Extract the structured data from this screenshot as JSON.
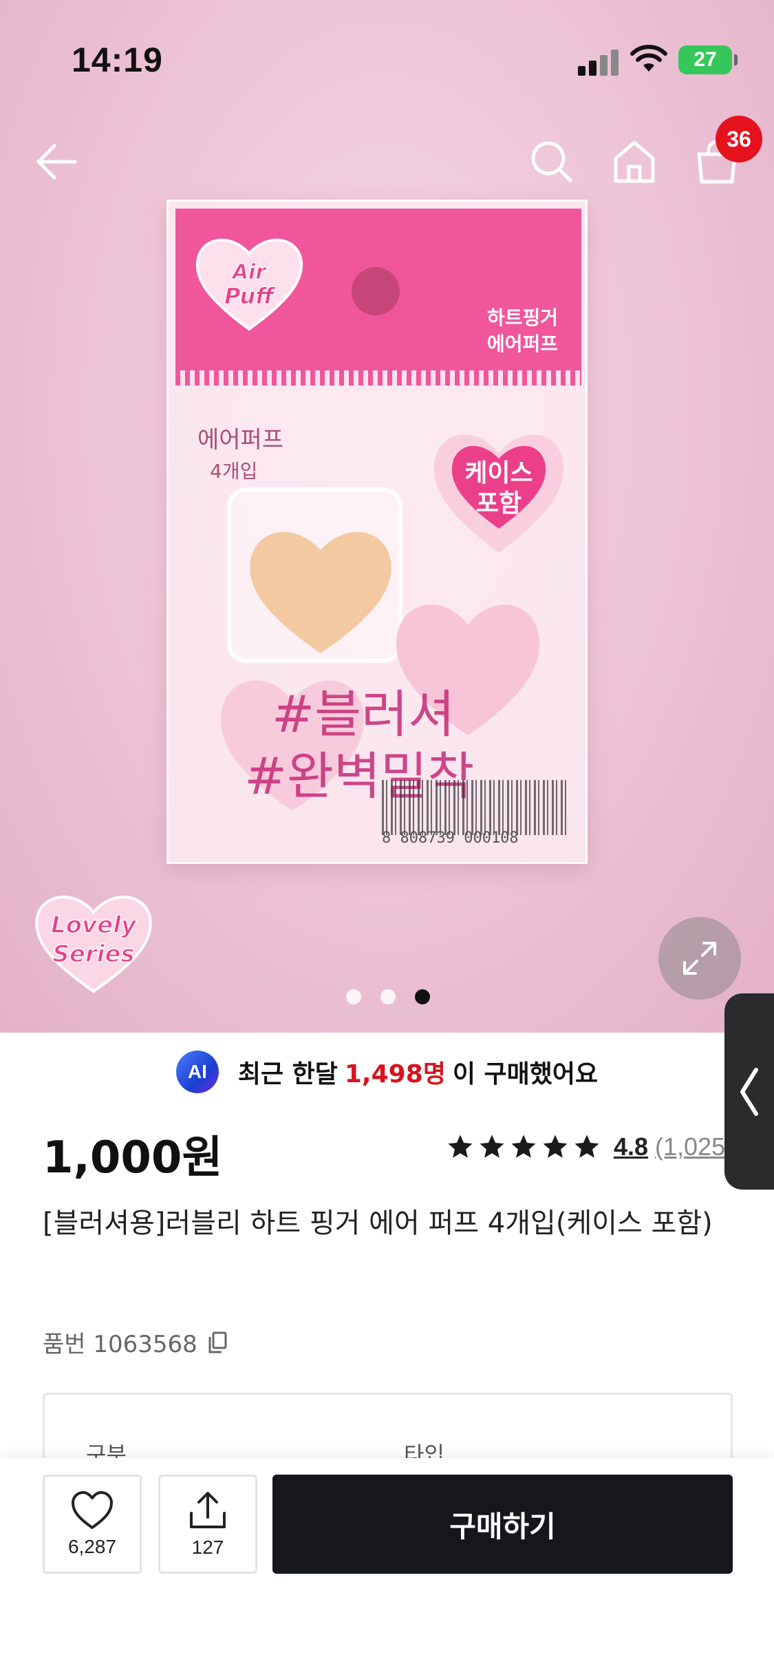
{
  "status_bar": {
    "time": "14:19",
    "battery": "27"
  },
  "header": {
    "cart_count": "36"
  },
  "gallery": {
    "total_images": 3,
    "active_index": 2
  },
  "package": {
    "brand_logo": "Air Puff",
    "label_line1": "하트핑거",
    "label_line2": "에어퍼프",
    "side_text": "에어퍼프",
    "count_text": "4개입",
    "sticker_line1": "케이스",
    "sticker_line2": "포함",
    "hashtag1": "#블러셔",
    "hashtag2": "#완벽밀착",
    "barcode_number": "8 808739 000108",
    "series_logo": "Lovely Series"
  },
  "social_proof": {
    "badge": "AI",
    "prefix": "최근 한달",
    "count": "1,498명",
    "suffix": "이 구매했어요"
  },
  "product": {
    "price": "1,000원",
    "rating": "4.8",
    "review_count": "(1,025",
    "title": "[블러셔용]러블리 하트 핑거 에어 퍼프 4개입(케이스 포함)",
    "sku": "품번 1063568"
  },
  "options": {
    "col1": "구분",
    "col2": "타입"
  },
  "bottom_bar": {
    "likes": "6,287",
    "shares": "127",
    "buy_label": "구매하기"
  },
  "colors": {
    "accent_red": "#e4121d",
    "highlight_red": "#d7141f",
    "buy_button": "#15171c",
    "package_pink": "#f0569c"
  }
}
